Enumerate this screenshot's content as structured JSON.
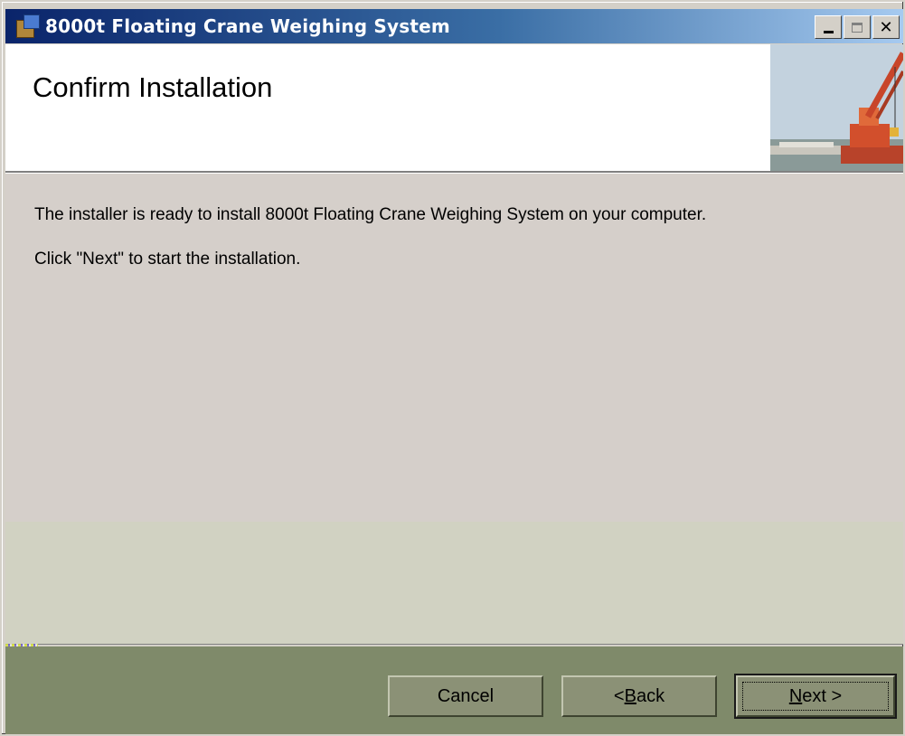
{
  "window": {
    "title": "8000t Floating Crane Weighing System",
    "minimize_glyph": "_",
    "maximize_glyph": "□",
    "close_glyph": "✕"
  },
  "banner": {
    "title": "Confirm Installation"
  },
  "body": {
    "line1": "The installer is ready to install 8000t Floating Crane Weighing System on your computer.",
    "line2": "Click \"Next\" to start the installation."
  },
  "buttons": {
    "cancel": "Cancel",
    "back_prefix": "< ",
    "back_key": "B",
    "back_rest": "ack",
    "next_key": "N",
    "next_rest": "ext >"
  },
  "colors": {
    "titlebar_start": "#0a246a",
    "titlebar_end": "#a6caf0",
    "footer": "#7f8a6a",
    "body": "#d5cfca"
  },
  "icons": {
    "app": "installer-app-icon",
    "banner": "crane-photo"
  }
}
